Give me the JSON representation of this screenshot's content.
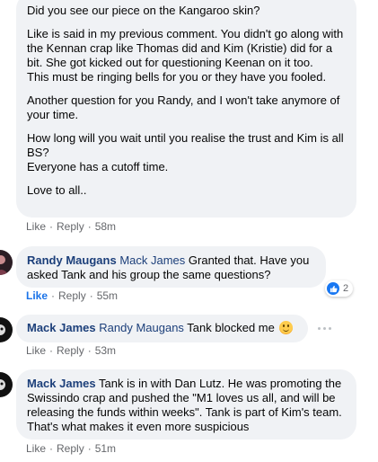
{
  "comment1": {
    "paragraphs": [
      "Did you see our piece on the Kangaroo skin?",
      "Like is said in my previous comment. You didn't go along with the Kennan crap like Thomas did and Kim (Kristie) did for a bit. She got kicked out for questioning Keenan on it too.\nThis must be ringing bells for you or they have you fooled.",
      "Another question for you Randy, and I won't take anymore of your time.",
      "How long will you wait until you realise the trust and Kim is all BS?\nEveryone has a cutoff time.",
      "Love to all.."
    ],
    "actions": {
      "like": "Like",
      "reply": "Reply",
      "time": "58m"
    }
  },
  "comment2": {
    "author": "Randy Maugans",
    "mention": "Mack James",
    "text": " Granted that. Have you asked Tank and his group the same questions?",
    "actions": {
      "like": "Like",
      "reply": "Reply",
      "time": "55m"
    },
    "reaction_count": "2",
    "liked_color": "#1a73e8"
  },
  "comment3": {
    "author": "Mack James",
    "mention": "Randy Maugans",
    "text": " Tank blocked me ",
    "emoji": "smiley-emoji",
    "actions": {
      "like": "Like",
      "reply": "Reply",
      "time": "53m"
    }
  },
  "comment4": {
    "author": "Mack James",
    "text": " Tank is in with Dan Lutz. He was promoting the Swissindo crap and pushed the \"M1 loves us all, and will be releasing the funds within weeks\". Tank is part of Kim's team. That's what makes it even more suspicious",
    "actions": {
      "like": "Like",
      "reply": "Reply",
      "time": "51m"
    }
  },
  "colors": {
    "bubble": "#f0f2f5",
    "author": "#1c3f7a",
    "meta": "#65676b",
    "like_blue": "#1877f2"
  }
}
